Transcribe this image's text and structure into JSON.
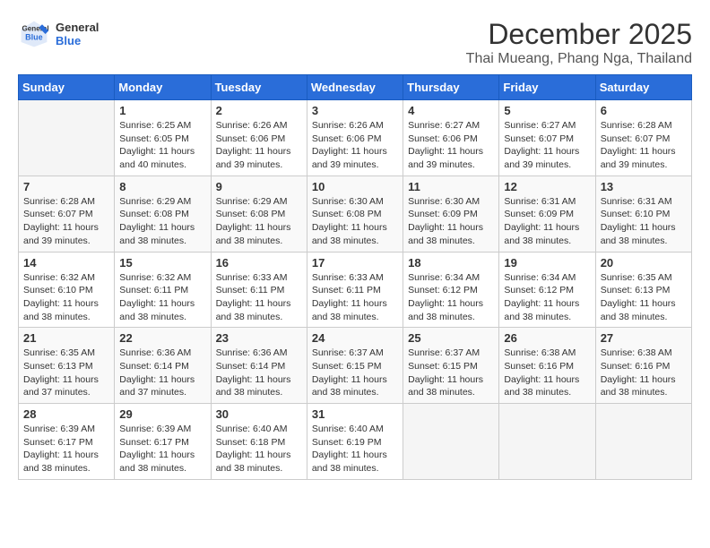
{
  "logo": {
    "general": "General",
    "blue": "Blue"
  },
  "header": {
    "month_year": "December 2025",
    "location": "Thai Mueang, Phang Nga, Thailand"
  },
  "weekdays": [
    "Sunday",
    "Monday",
    "Tuesday",
    "Wednesday",
    "Thursday",
    "Friday",
    "Saturday"
  ],
  "weeks": [
    [
      {
        "day": "",
        "empty": true
      },
      {
        "day": "1",
        "sunrise": "Sunrise: 6:25 AM",
        "sunset": "Sunset: 6:05 PM",
        "daylight": "Daylight: 11 hours and 40 minutes."
      },
      {
        "day": "2",
        "sunrise": "Sunrise: 6:26 AM",
        "sunset": "Sunset: 6:06 PM",
        "daylight": "Daylight: 11 hours and 39 minutes."
      },
      {
        "day": "3",
        "sunrise": "Sunrise: 6:26 AM",
        "sunset": "Sunset: 6:06 PM",
        "daylight": "Daylight: 11 hours and 39 minutes."
      },
      {
        "day": "4",
        "sunrise": "Sunrise: 6:27 AM",
        "sunset": "Sunset: 6:06 PM",
        "daylight": "Daylight: 11 hours and 39 minutes."
      },
      {
        "day": "5",
        "sunrise": "Sunrise: 6:27 AM",
        "sunset": "Sunset: 6:07 PM",
        "daylight": "Daylight: 11 hours and 39 minutes."
      },
      {
        "day": "6",
        "sunrise": "Sunrise: 6:28 AM",
        "sunset": "Sunset: 6:07 PM",
        "daylight": "Daylight: 11 hours and 39 minutes."
      }
    ],
    [
      {
        "day": "7",
        "sunrise": "Sunrise: 6:28 AM",
        "sunset": "Sunset: 6:07 PM",
        "daylight": "Daylight: 11 hours and 39 minutes."
      },
      {
        "day": "8",
        "sunrise": "Sunrise: 6:29 AM",
        "sunset": "Sunset: 6:08 PM",
        "daylight": "Daylight: 11 hours and 38 minutes."
      },
      {
        "day": "9",
        "sunrise": "Sunrise: 6:29 AM",
        "sunset": "Sunset: 6:08 PM",
        "daylight": "Daylight: 11 hours and 38 minutes."
      },
      {
        "day": "10",
        "sunrise": "Sunrise: 6:30 AM",
        "sunset": "Sunset: 6:08 PM",
        "daylight": "Daylight: 11 hours and 38 minutes."
      },
      {
        "day": "11",
        "sunrise": "Sunrise: 6:30 AM",
        "sunset": "Sunset: 6:09 PM",
        "daylight": "Daylight: 11 hours and 38 minutes."
      },
      {
        "day": "12",
        "sunrise": "Sunrise: 6:31 AM",
        "sunset": "Sunset: 6:09 PM",
        "daylight": "Daylight: 11 hours and 38 minutes."
      },
      {
        "day": "13",
        "sunrise": "Sunrise: 6:31 AM",
        "sunset": "Sunset: 6:10 PM",
        "daylight": "Daylight: 11 hours and 38 minutes."
      }
    ],
    [
      {
        "day": "14",
        "sunrise": "Sunrise: 6:32 AM",
        "sunset": "Sunset: 6:10 PM",
        "daylight": "Daylight: 11 hours and 38 minutes."
      },
      {
        "day": "15",
        "sunrise": "Sunrise: 6:32 AM",
        "sunset": "Sunset: 6:11 PM",
        "daylight": "Daylight: 11 hours and 38 minutes."
      },
      {
        "day": "16",
        "sunrise": "Sunrise: 6:33 AM",
        "sunset": "Sunset: 6:11 PM",
        "daylight": "Daylight: 11 hours and 38 minutes."
      },
      {
        "day": "17",
        "sunrise": "Sunrise: 6:33 AM",
        "sunset": "Sunset: 6:11 PM",
        "daylight": "Daylight: 11 hours and 38 minutes."
      },
      {
        "day": "18",
        "sunrise": "Sunrise: 6:34 AM",
        "sunset": "Sunset: 6:12 PM",
        "daylight": "Daylight: 11 hours and 38 minutes."
      },
      {
        "day": "19",
        "sunrise": "Sunrise: 6:34 AM",
        "sunset": "Sunset: 6:12 PM",
        "daylight": "Daylight: 11 hours and 38 minutes."
      },
      {
        "day": "20",
        "sunrise": "Sunrise: 6:35 AM",
        "sunset": "Sunset: 6:13 PM",
        "daylight": "Daylight: 11 hours and 38 minutes."
      }
    ],
    [
      {
        "day": "21",
        "sunrise": "Sunrise: 6:35 AM",
        "sunset": "Sunset: 6:13 PM",
        "daylight": "Daylight: 11 hours and 37 minutes."
      },
      {
        "day": "22",
        "sunrise": "Sunrise: 6:36 AM",
        "sunset": "Sunset: 6:14 PM",
        "daylight": "Daylight: 11 hours and 37 minutes."
      },
      {
        "day": "23",
        "sunrise": "Sunrise: 6:36 AM",
        "sunset": "Sunset: 6:14 PM",
        "daylight": "Daylight: 11 hours and 38 minutes."
      },
      {
        "day": "24",
        "sunrise": "Sunrise: 6:37 AM",
        "sunset": "Sunset: 6:15 PM",
        "daylight": "Daylight: 11 hours and 38 minutes."
      },
      {
        "day": "25",
        "sunrise": "Sunrise: 6:37 AM",
        "sunset": "Sunset: 6:15 PM",
        "daylight": "Daylight: 11 hours and 38 minutes."
      },
      {
        "day": "26",
        "sunrise": "Sunrise: 6:38 AM",
        "sunset": "Sunset: 6:16 PM",
        "daylight": "Daylight: 11 hours and 38 minutes."
      },
      {
        "day": "27",
        "sunrise": "Sunrise: 6:38 AM",
        "sunset": "Sunset: 6:16 PM",
        "daylight": "Daylight: 11 hours and 38 minutes."
      }
    ],
    [
      {
        "day": "28",
        "sunrise": "Sunrise: 6:39 AM",
        "sunset": "Sunset: 6:17 PM",
        "daylight": "Daylight: 11 hours and 38 minutes."
      },
      {
        "day": "29",
        "sunrise": "Sunrise: 6:39 AM",
        "sunset": "Sunset: 6:17 PM",
        "daylight": "Daylight: 11 hours and 38 minutes."
      },
      {
        "day": "30",
        "sunrise": "Sunrise: 6:40 AM",
        "sunset": "Sunset: 6:18 PM",
        "daylight": "Daylight: 11 hours and 38 minutes."
      },
      {
        "day": "31",
        "sunrise": "Sunrise: 6:40 AM",
        "sunset": "Sunset: 6:19 PM",
        "daylight": "Daylight: 11 hours and 38 minutes."
      },
      {
        "day": "",
        "empty": true
      },
      {
        "day": "",
        "empty": true
      },
      {
        "day": "",
        "empty": true
      }
    ]
  ]
}
